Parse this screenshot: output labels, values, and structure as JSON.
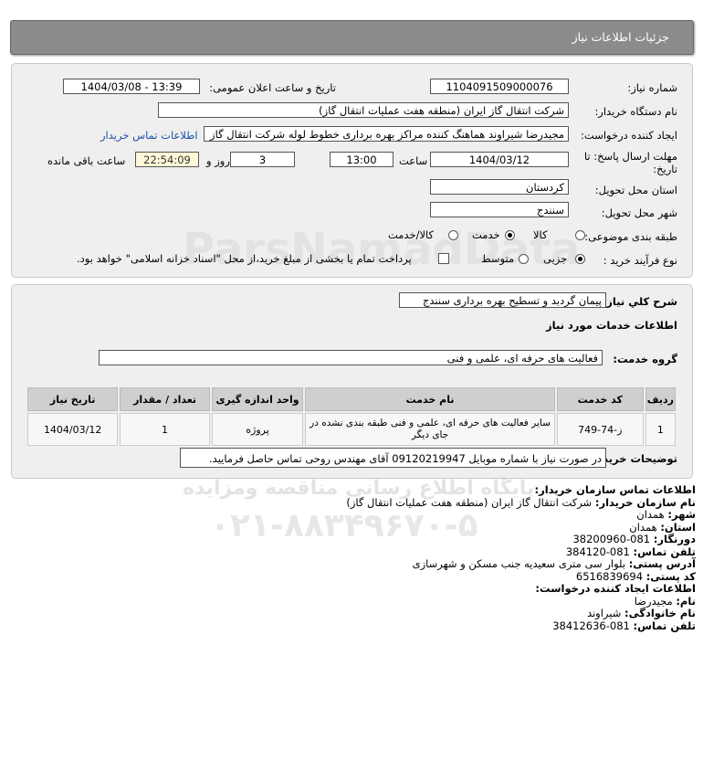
{
  "header": {
    "title": "جزئیات اطلاعات نیاز"
  },
  "form": {
    "need_number_label": "شماره نیاز:",
    "need_number": "1104091509000076",
    "announce_label": "تاریخ و ساعت اعلان عمومی:",
    "announce_value": "1404/03/08 - 13:39",
    "buyer_label": "نام دستگاه خریدار:",
    "buyer_value": "شرکت انتقال گاز ایران (منطقه هفت عملیات انتقال گاز)",
    "creator_label": "ایجاد کننده درخواست:",
    "creator_value": "مجیدرضا شیراوند هماهنگ کننده مراکز بهره برداری خطوط لوله  شرکت انتقال گاز",
    "contact_link": "اطلاعات تماس خریدار",
    "deadline_label_1": "مهلت ارسال پاسخ: تا",
    "deadline_label_2": "تاریخ:",
    "deadline_date": "1404/03/12",
    "time_label": "ساعت",
    "deadline_time": "13:00",
    "days_value": "3",
    "days_label": "روز و",
    "remaining_value": "22:54:09",
    "remaining_label": "ساعت باقی مانده",
    "province_label": "استان محل تحویل:",
    "province_value": "کردستان",
    "city_label": "شهر محل تحویل:",
    "city_value": "سنندج",
    "category_label": "طبقه بندی موضوعی:",
    "category_options": [
      "کالا",
      "خدمت",
      "کالا/خدمت"
    ],
    "category_selected": "خدمت",
    "process_label": "نوع فرآیند خرید :",
    "process_options": [
      "جزیی",
      "متوسط"
    ],
    "process_selected": "جزیی",
    "treasury_text": "پرداخت تمام یا بخشی از مبلغ خرید،از محل \"اسناد خزانه اسلامی\" خواهد بود."
  },
  "details": {
    "summary_label": "شرح کلي نياز:",
    "summary_value": "پیمان گردبد و تسطیح بهره برداری سنندج",
    "services_heading": "اطلاعات خدمات مورد نياز",
    "group_label": "گروه خدمت:",
    "group_value": "فعالیت های حرفه ای، علمی و فنی",
    "table": {
      "headers": [
        "ردیف",
        "کد خدمت",
        "نام خدمت",
        "واحد اندازه گیری",
        "تعداد / مقدار",
        "تاریخ نیاز"
      ],
      "rows": [
        [
          "1",
          "ز-74-749",
          "سایر فعالیت های حرفه ای، علمی و فنی طبقه بندی نشده در جای دیگر",
          "پروژه",
          "1",
          "1404/03/12"
        ]
      ]
    },
    "notes_label": "توضیحات خریدار:",
    "notes_value": "در صورت نیاز با شماره موبایل 09120219947 آقای مهندس روحی تماس حاصل فرمایید."
  },
  "contact": {
    "org_heading": "اطلاعات تماس سازمان خریدار:",
    "org_name_label": "نام سازمان خریدار:",
    "org_name_value": "شرکت انتقال گاز ایران (منطقه هفت عملیات انتقال گاز)",
    "city_label": "شهر:",
    "city_value": "همدان",
    "province_label": "استان:",
    "province_value": "همدان",
    "fax_label": "دورنگار:",
    "fax_value": "081-38200960",
    "phone_label": "تلفن تماس:",
    "phone_value": "081-384120",
    "address_label": "آدرس پستی:",
    "address_value": "بلوار سی متری سعیدیه جنب مسکن و شهرسازی",
    "postal_label": "کد پستی:",
    "postal_value": "6516839694",
    "creator_heading": "اطلاعات ایجاد کننده درخواست:",
    "first_name_label": "نام:",
    "first_name_value": "مجیدرضا",
    "last_name_label": "نام خانوادگی:",
    "last_name_value": "شیراوند",
    "creator_phone_label": "تلفن تماس:",
    "creator_phone_value": "081-38412636"
  },
  "watermark": {
    "brand": "ParsNamadData",
    "tagline": "پایگاه اطلاع رسانی مناقصه ومزایده",
    "phone": "۰۲۱-۸۸۳۴۹۶۷۰-۵"
  }
}
